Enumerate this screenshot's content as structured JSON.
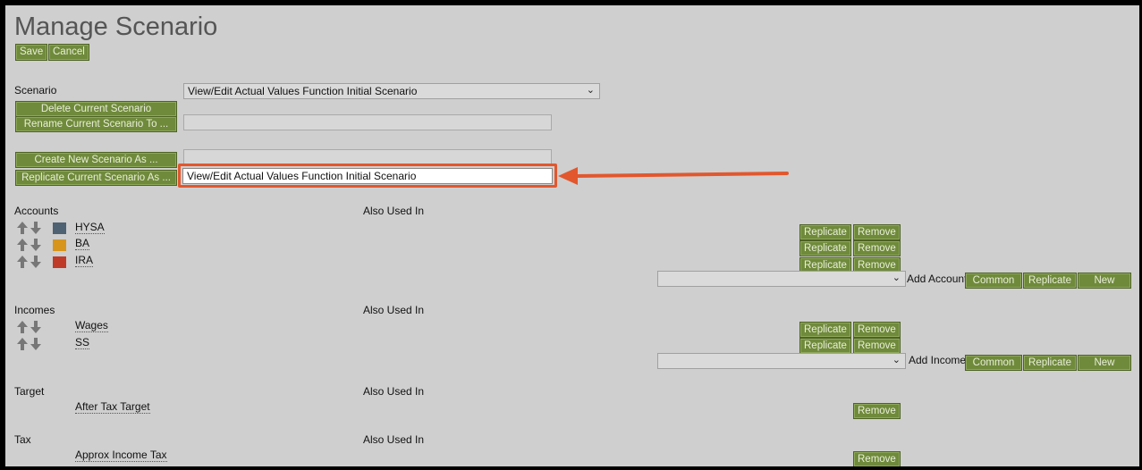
{
  "page": {
    "title": "Manage Scenario"
  },
  "toolbar": {
    "save_label": "Save",
    "cancel_label": "Cancel"
  },
  "scenario": {
    "label": "Scenario",
    "selected": "View/Edit Actual Values Function Initial Scenario",
    "delete_label": "Delete Current Scenario",
    "rename_label": "Rename Current Scenario To ...",
    "rename_value": "",
    "create_label": "Create New Scenario As ...",
    "create_value": "",
    "replicate_label": "Replicate Current Scenario As ...",
    "replicate_value": "View/Edit Actual Values Function Initial Scenario"
  },
  "accounts": {
    "header": "Accounts",
    "also_used": "Also Used In",
    "items": [
      {
        "name": "HYSA",
        "color": "#4f6273"
      },
      {
        "name": "BA",
        "color": "#d7951c"
      },
      {
        "name": "IRA",
        "color": "#bf3b27"
      }
    ],
    "add_label": "Add Account",
    "add_selected": ""
  },
  "incomes": {
    "header": "Incomes",
    "also_used": "Also Used In",
    "items": [
      {
        "name": "Wages"
      },
      {
        "name": "SS"
      }
    ],
    "add_label": "Add Income",
    "add_selected": ""
  },
  "target": {
    "header": "Target",
    "also_used": "Also Used In",
    "item": "After Tax Target"
  },
  "tax": {
    "header": "Tax",
    "also_used": "Also Used In",
    "item": "Approx Income Tax"
  },
  "buttons": {
    "replicate": "Replicate",
    "remove": "Remove",
    "common": "Common",
    "new": "New"
  },
  "colors": {
    "button_bg": "#6f8a3b",
    "highlight": "#e2572e",
    "panel_bg": "#cfcfcf"
  },
  "icons": {
    "move_up": "up-arrow-icon",
    "move_down": "down-arrow-icon",
    "dropdown": "chevron-down-icon"
  }
}
